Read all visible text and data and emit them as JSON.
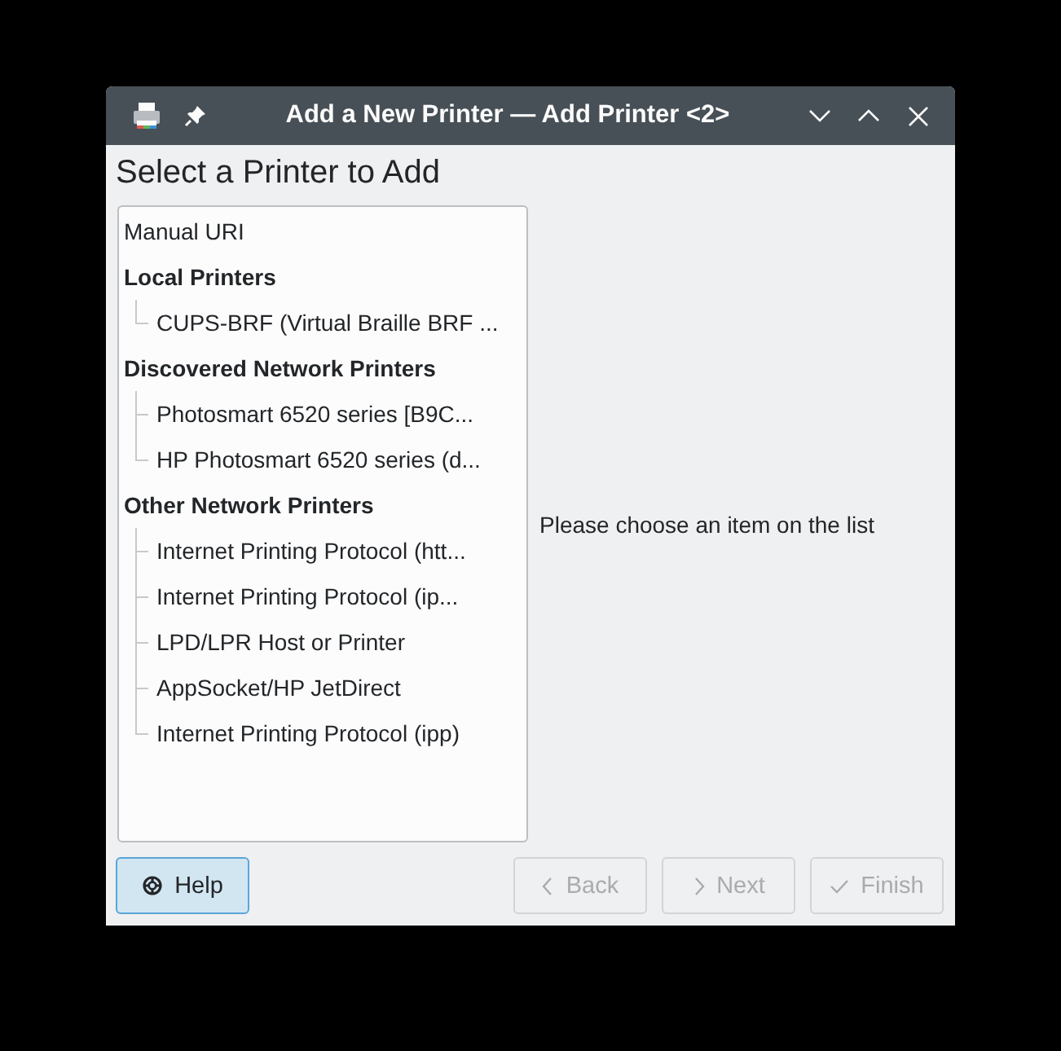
{
  "window": {
    "title": "Add a New Printer — Add Printer <2>"
  },
  "heading": "Select a Printer to Add",
  "list": [
    {
      "kind": "item",
      "label": "Manual URI"
    },
    {
      "kind": "category",
      "label": "Local Printers",
      "children": [
        {
          "label": "CUPS-BRF (Virtual Braille BRF ..."
        }
      ]
    },
    {
      "kind": "category",
      "label": "Discovered Network Printers",
      "children": [
        {
          "label": "Photosmart 6520 series [B9C..."
        },
        {
          "label": "HP Photosmart 6520 series (d..."
        }
      ]
    },
    {
      "kind": "category",
      "label": "Other Network Printers",
      "children": [
        {
          "label": "Internet Printing Protocol (htt..."
        },
        {
          "label": "Internet Printing Protocol (ip..."
        },
        {
          "label": "LPD/LPR Host or Printer"
        },
        {
          "label": "AppSocket/HP JetDirect"
        },
        {
          "label": "Internet Printing Protocol (ipp)"
        }
      ]
    }
  ],
  "hint": "Please choose an item on the list",
  "buttons": [
    {
      "kind": "help",
      "label": "Help",
      "disabled": false,
      "hovered": true
    },
    {
      "kind": "back",
      "label": "Back",
      "disabled": true,
      "hovered": false
    },
    {
      "kind": "next",
      "label": "Next",
      "disabled": true,
      "hovered": false
    },
    {
      "kind": "finish",
      "label": "Finish",
      "disabled": true,
      "hovered": false
    }
  ]
}
